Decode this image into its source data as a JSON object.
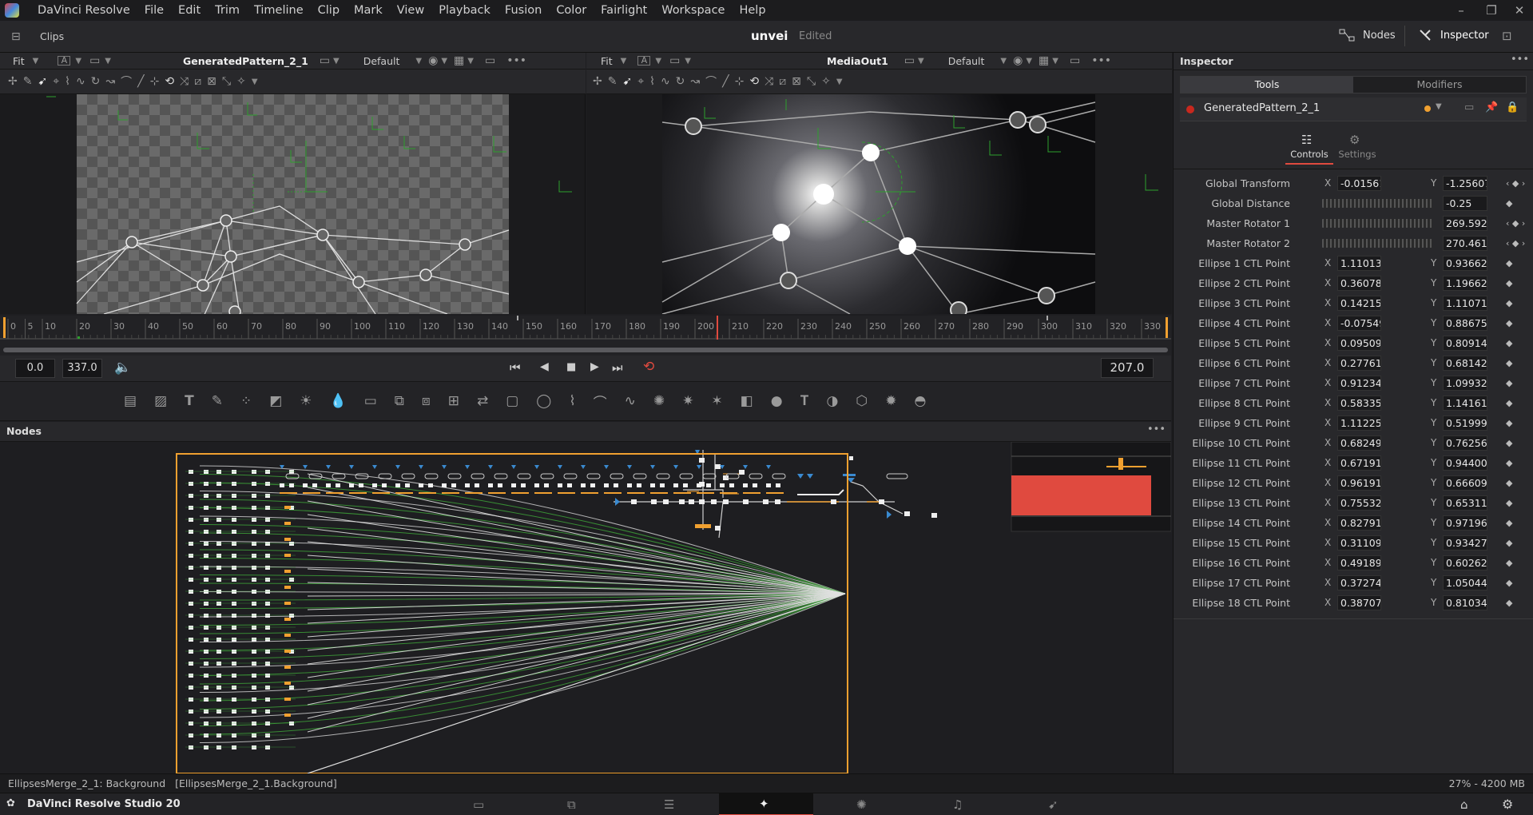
{
  "app": {
    "name": "DaVinci Resolve"
  },
  "menu": [
    "File",
    "Edit",
    "Trim",
    "Timeline",
    "Clip",
    "Mark",
    "View",
    "Playback",
    "Fusion",
    "Color",
    "Fairlight",
    "Workspace",
    "Help"
  ],
  "titlebar": {
    "clips_label": "Clips",
    "project": "unvei",
    "status": "Edited",
    "nodes_label": "Nodes",
    "inspector_label": "Inspector"
  },
  "viewer_left": {
    "fit": "Fit",
    "name": "GeneratedPattern_2_1",
    "lut": "Default"
  },
  "viewer_right": {
    "fit": "Fit",
    "name": "MediaOut1",
    "lut": "Default"
  },
  "ruler_ticks": [
    "0",
    "5",
    "10",
    "20",
    "30",
    "40",
    "50",
    "60",
    "70",
    "80",
    "90",
    "100",
    "110",
    "120",
    "130",
    "140",
    "150",
    "160",
    "170",
    "180",
    "190",
    "200",
    "210",
    "220",
    "230",
    "240",
    "250",
    "260",
    "270",
    "280",
    "290",
    "300",
    "310",
    "320",
    "330"
  ],
  "transport": {
    "start": "0.0",
    "end": "337.0",
    "current_frame": "207.0"
  },
  "nodes": {
    "title": "Nodes"
  },
  "status": {
    "left": "EllipsesMerge_2_1: Background   [EllipsesMerge_2_1.Background]",
    "right": "27% - 4200 MB"
  },
  "pagebar": {
    "product": "DaVinci Resolve Studio 20"
  },
  "inspector": {
    "title": "Inspector",
    "tabs": [
      "Tools",
      "Modifiers"
    ],
    "node_name": "GeneratedPattern_2_1",
    "subtabs": [
      "Controls",
      "Settings"
    ],
    "params": [
      {
        "label": "Global Transform",
        "x": "-0.015610",
        "y": "-1.25607"
      },
      {
        "label": "Global Distance",
        "slider": true,
        "value": "-0.25"
      },
      {
        "label": "Master Rotator 1",
        "slider": true,
        "value": "269.5924"
      },
      {
        "label": "Master Rotator 2",
        "slider": true,
        "value": "270.4613"
      },
      {
        "label": "Ellipse 1 CTL Point",
        "x": "1.110131",
        "y": "0.936621"
      },
      {
        "label": "Ellipse 2 CTL Point",
        "x": "0.360784",
        "y": "1.19662"
      },
      {
        "label": "Ellipse 3 CTL Point",
        "x": "0.142156",
        "y": "1.110713"
      },
      {
        "label": "Ellipse 4 CTL Point",
        "x": "-0.075490",
        "y": "0.886759"
      },
      {
        "label": "Ellipse 5 CTL Point",
        "x": "0.095098",
        "y": "0.809147"
      },
      {
        "label": "Ellipse 6 CTL Point",
        "x": "0.277614",
        "y": "0.681429"
      },
      {
        "label": "Ellipse 7 CTL Point",
        "x": "0.912341",
        "y": "1.099327"
      },
      {
        "label": "Ellipse 8 CTL Point",
        "x": "0.583357",
        "y": "1.141612"
      },
      {
        "label": "Ellipse 9 CTL Point",
        "x": "1.112252",
        "y": "0.519992"
      },
      {
        "label": "Ellipse 10 CTL Point",
        "x": "0.682491",
        "y": "0.762564"
      },
      {
        "label": "Ellipse 11 CTL Point",
        "x": "0.671912",
        "y": "0.944003"
      },
      {
        "label": "Ellipse 12 CTL Point",
        "x": "0.961914",
        "y": "0.666095"
      },
      {
        "label": "Ellipse 13 CTL Point",
        "x": "0.755328",
        "y": "0.653114"
      },
      {
        "label": "Ellipse 14 CTL Point",
        "x": "0.827911",
        "y": "0.971965"
      },
      {
        "label": "Ellipse 15 CTL Point",
        "x": "0.311090",
        "y": "0.934274"
      },
      {
        "label": "Ellipse 16 CTL Point",
        "x": "0.491892",
        "y": "0.602621"
      },
      {
        "label": "Ellipse 17 CTL Point",
        "x": "0.372746",
        "y": "1.050441"
      },
      {
        "label": "Ellipse 18 CTL Point",
        "x": "0.387070",
        "y": "0.810345"
      }
    ]
  },
  "colors": {
    "accent_red": "#e04a3f",
    "selection_orange": "#f0a030",
    "node_link_green": "#3fa83a"
  }
}
